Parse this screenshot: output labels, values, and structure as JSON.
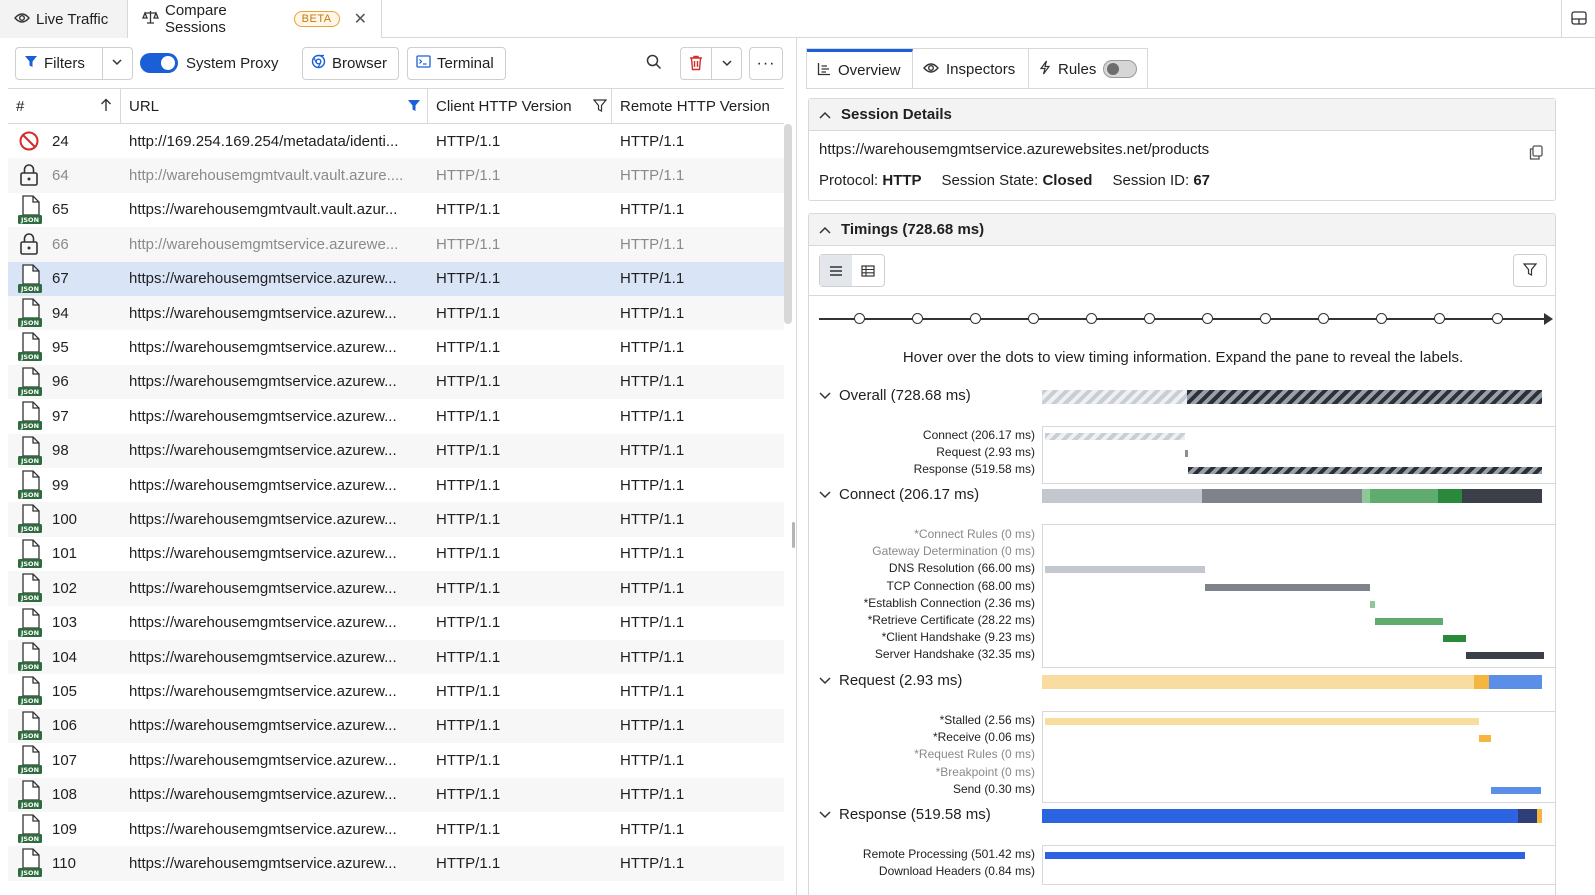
{
  "tabs": {
    "live": "Live Traffic",
    "compare": "Compare Sessions",
    "beta": "BETA"
  },
  "toolbar": {
    "filters": "Filters",
    "system_proxy": "System Proxy",
    "browser": "Browser",
    "terminal": "Terminal"
  },
  "grid": {
    "columns": [
      "#",
      "URL",
      "Client HTTP Version",
      "Remote HTTP Version"
    ],
    "rows": [
      {
        "id": "24",
        "url": "http://169.254.169.254/metadata/identi...",
        "client": "HTTP/1.1",
        "remote": "HTTP/1.1",
        "icon": "blocked-icon"
      },
      {
        "id": "64",
        "url": "http://warehousemgmtvault.vault.azure....",
        "client": "HTTP/1.1",
        "remote": "HTTP/1.1",
        "icon": "lock-icon"
      },
      {
        "id": "65",
        "url": "https://warehousemgmtvault.vault.azur...",
        "client": "HTTP/1.1",
        "remote": "HTTP/1.1",
        "icon": "json-file-icon"
      },
      {
        "id": "66",
        "url": "http://warehousemgmtservice.azurewe...",
        "client": "HTTP/1.1",
        "remote": "HTTP/1.1",
        "icon": "lock-icon"
      },
      {
        "id": "67",
        "url": "https://warehousemgmtservice.azurew...",
        "client": "HTTP/1.1",
        "remote": "HTTP/1.1",
        "icon": "json-file-icon"
      },
      {
        "id": "94",
        "url": "https://warehousemgmtservice.azurew...",
        "client": "HTTP/1.1",
        "remote": "HTTP/1.1",
        "icon": "json-file-icon"
      },
      {
        "id": "95",
        "url": "https://warehousemgmtservice.azurew...",
        "client": "HTTP/1.1",
        "remote": "HTTP/1.1",
        "icon": "json-file-icon"
      },
      {
        "id": "96",
        "url": "https://warehousemgmtservice.azurew...",
        "client": "HTTP/1.1",
        "remote": "HTTP/1.1",
        "icon": "json-file-icon"
      },
      {
        "id": "97",
        "url": "https://warehousemgmtservice.azurew...",
        "client": "HTTP/1.1",
        "remote": "HTTP/1.1",
        "icon": "json-file-icon"
      },
      {
        "id": "98",
        "url": "https://warehousemgmtservice.azurew...",
        "client": "HTTP/1.1",
        "remote": "HTTP/1.1",
        "icon": "json-file-icon"
      },
      {
        "id": "99",
        "url": "https://warehousemgmtservice.azurew...",
        "client": "HTTP/1.1",
        "remote": "HTTP/1.1",
        "icon": "json-file-icon"
      },
      {
        "id": "100",
        "url": "https://warehousemgmtservice.azurew...",
        "client": "HTTP/1.1",
        "remote": "HTTP/1.1",
        "icon": "json-file-icon"
      },
      {
        "id": "101",
        "url": "https://warehousemgmtservice.azurew...",
        "client": "HTTP/1.1",
        "remote": "HTTP/1.1",
        "icon": "json-file-icon"
      },
      {
        "id": "102",
        "url": "https://warehousemgmtservice.azurew...",
        "client": "HTTP/1.1",
        "remote": "HTTP/1.1",
        "icon": "json-file-icon"
      },
      {
        "id": "103",
        "url": "https://warehousemgmtservice.azurew...",
        "client": "HTTP/1.1",
        "remote": "HTTP/1.1",
        "icon": "json-file-icon"
      },
      {
        "id": "104",
        "url": "https://warehousemgmtservice.azurew...",
        "client": "HTTP/1.1",
        "remote": "HTTP/1.1",
        "icon": "json-file-icon"
      },
      {
        "id": "105",
        "url": "https://warehousemgmtservice.azurew...",
        "client": "HTTP/1.1",
        "remote": "HTTP/1.1",
        "icon": "json-file-icon"
      },
      {
        "id": "106",
        "url": "https://warehousemgmtservice.azurew...",
        "client": "HTTP/1.1",
        "remote": "HTTP/1.1",
        "icon": "json-file-icon"
      },
      {
        "id": "107",
        "url": "https://warehousemgmtservice.azurew...",
        "client": "HTTP/1.1",
        "remote": "HTTP/1.1",
        "icon": "json-file-icon"
      },
      {
        "id": "108",
        "url": "https://warehousemgmtservice.azurew...",
        "client": "HTTP/1.1",
        "remote": "HTTP/1.1",
        "icon": "json-file-icon"
      },
      {
        "id": "109",
        "url": "https://warehousemgmtservice.azurew...",
        "client": "HTTP/1.1",
        "remote": "HTTP/1.1",
        "icon": "json-file-icon"
      },
      {
        "id": "110",
        "url": "https://warehousemgmtservice.azurew...",
        "client": "HTTP/1.1",
        "remote": "HTTP/1.1",
        "icon": "json-file-icon"
      }
    ],
    "json_badge": "JSON"
  },
  "inspector": {
    "tabs": [
      "Overview",
      "Inspectors",
      "Rules"
    ],
    "session": {
      "title": "Session Details",
      "url": "https://warehousemgmtservice.azurewebsites.net/products",
      "protocol_label": "Protocol:",
      "protocol": "HTTP",
      "state_label": "Session State:",
      "state": "Closed",
      "id_label": "Session ID:",
      "id": "67"
    },
    "timings": {
      "title": "Timings (728.68 ms)",
      "hint": "Hover over the dots to view timing information. Expand the pane to reveal the labels.",
      "groups": [
        {
          "label": "Overall (728.68 ms)",
          "items": [
            {
              "label": "Connect",
              "value": "(206.17 ms)"
            },
            {
              "label": "Request",
              "value": "(2.93 ms)"
            },
            {
              "label": "Response",
              "value": "(519.58 ms)"
            }
          ]
        },
        {
          "label": "Connect (206.17 ms)",
          "items": [
            {
              "label": "*Connect Rules",
              "value": "(0 ms)"
            },
            {
              "label": "Gateway Determination",
              "value": "(0 ms)"
            },
            {
              "label": "DNS Resolution",
              "value": "(66.00 ms)"
            },
            {
              "label": "TCP Connection",
              "value": "(68.00 ms)"
            },
            {
              "label": "*Establish Connection",
              "value": "(2.36 ms)"
            },
            {
              "label": "*Retrieve Certificate",
              "value": "(28.22 ms)"
            },
            {
              "label": "*Client Handshake",
              "value": "(9.23 ms)"
            },
            {
              "label": "Server Handshake",
              "value": "(32.35 ms)"
            }
          ]
        },
        {
          "label": "Request (2.93 ms)",
          "items": [
            {
              "label": "*Stalled",
              "value": "(2.56 ms)"
            },
            {
              "label": "*Receive",
              "value": "(0.06 ms)"
            },
            {
              "label": "*Request Rules",
              "value": "(0 ms)"
            },
            {
              "label": "*Breakpoint",
              "value": "(0 ms)"
            },
            {
              "label": "Send",
              "value": "(0.30 ms)"
            }
          ]
        },
        {
          "label": "Response (519.58 ms)",
          "items": [
            {
              "label": "Remote Processing",
              "value": "(501.42 ms)"
            },
            {
              "label": "Download Headers",
              "value": "(0.84 ms)"
            }
          ]
        }
      ]
    }
  },
  "colors": {
    "accent": "#1a5fd8",
    "selected_row": "#d9e4f7",
    "json_badge": "#2e6b3e",
    "blocked": "#d12c2c",
    "dns": "#c3c7ce",
    "tcp": "#7e838b",
    "establish": "#8fc79a",
    "certificate": "#5fac6e",
    "client_handshake": "#2a8a3c",
    "server_handshake": "#3b3f47",
    "stalled": "#f8dca0",
    "receive": "#f4b63f",
    "send": "#5b8ee6",
    "response": "#2b63e0"
  }
}
